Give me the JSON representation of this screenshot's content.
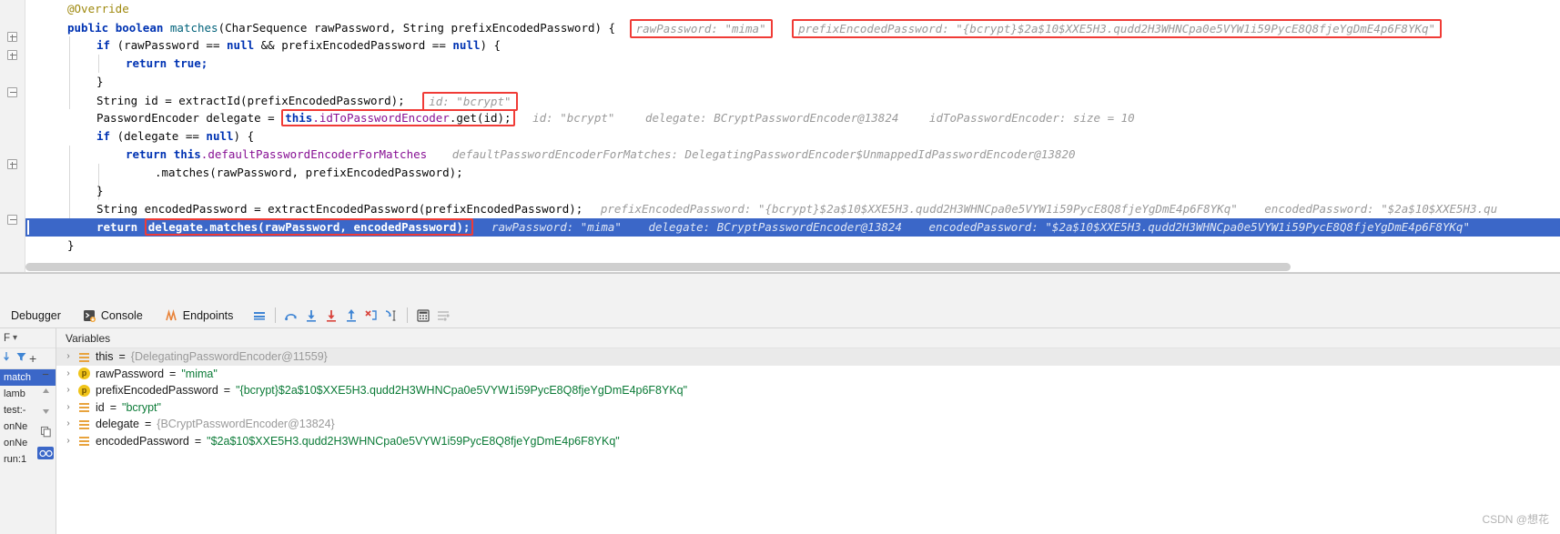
{
  "editor": {
    "lines": [
      {
        "id": "l1",
        "indent": 1,
        "text": "@Override"
      },
      {
        "id": "l2",
        "indent": 1,
        "text": "public boolean matches(CharSequence rawPassword, String prefixEncodedPassword) {"
      },
      {
        "id": "l3",
        "indent": 2,
        "text": "if (rawPassword == null && prefixEncodedPassword == null) {"
      },
      {
        "id": "l4",
        "indent": 3,
        "text": "return true;"
      },
      {
        "id": "l5",
        "indent": 2,
        "text": "}"
      },
      {
        "id": "l6",
        "indent": 2,
        "text": "String id = extractId(prefixEncodedPassword);"
      },
      {
        "id": "l7",
        "indent": 2,
        "text": "PasswordEncoder delegate = this.idToPasswordEncoder.get(id);"
      },
      {
        "id": "l8",
        "indent": 2,
        "text": "if (delegate == null) {"
      },
      {
        "id": "l9",
        "indent": 3,
        "text": "return this.defaultPasswordEncoderForMatches"
      },
      {
        "id": "l10",
        "indent": 4,
        "text": ".matches(rawPassword, prefixEncodedPassword);"
      },
      {
        "id": "l11",
        "indent": 2,
        "text": "}"
      },
      {
        "id": "l12",
        "indent": 2,
        "text": "String encodedPassword = extractEncodedPassword(prefixEncodedPassword);"
      },
      {
        "id": "l13",
        "indent": 2,
        "text": "return delegate.matches(rawPassword, encodedPassword);"
      },
      {
        "id": "l14",
        "indent": 1,
        "text": "}"
      }
    ],
    "tokens": {
      "annotation_override": "@Override",
      "kw_public": "public",
      "kw_boolean": "boolean",
      "method_matches": "matches",
      "sig_rest": "(CharSequence rawPassword, String prefixEncodedPassword) {",
      "kw_if": "if",
      "if_raw_null": "(rawPassword == ",
      "kw_null": "null",
      "and_prefix": " && prefixEncodedPassword == ",
      "close_brace_paren": ") {",
      "kw_return": "return",
      "kw_true": "true;",
      "brace_close": "}",
      "line6_a": "String id = extractId(prefixEncodedPassword);",
      "line7_a": "PasswordEncoder delegate = ",
      "line7_box": "this.idToPasswordEncoder.get(id);",
      "line7_this": "this",
      "line7_dot_field": ".idToPasswordEncoder",
      "line7_get": ".get(id);",
      "line8_a": "if (delegate == ",
      "line8_b": ") {",
      "line9_return": "return ",
      "line9_this": "this",
      "line9_field": ".defaultPasswordEncoderForMatches",
      "line10_a": ".matches(rawPassword, prefixEncodedPassword);",
      "line12_a": "String encodedPassword = extractEncodedPassword(prefixEncodedPassword);",
      "line13_return": "return ",
      "line13_box": "delegate.matches(rawPassword, encodedPassword);"
    },
    "inline_hints": {
      "raw_password": "rawPassword: \"mima\"",
      "prefix_encoded_password": "prefixEncodedPassword: \"{bcrypt}$2a$10$XXE5H3.qudd2H3WHNCpa0e5VYW1i59PycE8Q8fjeYgDmE4p6F8YKq\"",
      "id_bcrypt": "id: \"bcrypt\"",
      "id_bcrypt_2": "id: \"bcrypt\"",
      "delegate_bcrypt": "delegate: BCryptPasswordEncoder@13824",
      "idtopasswordencoder_size": "idToPasswordEncoder:  size = 10",
      "default_encoder_for_matches": "defaultPasswordEncoderForMatches: DelegatingPasswordEncoder$UnmappedIdPasswordEncoder@13820",
      "prefix_encoded_password_2": "prefixEncodedPassword: \"{bcrypt}$2a$10$XXE5H3.qudd2H3WHNCpa0e5VYW1i59PycE8Q8fjeYgDmE4p6F8YKq\"",
      "encoded_password_trunc": "encodedPassword: \"$2a$10$XXE5H3.qu",
      "raw_password_2": "rawPassword: \"mima\"",
      "delegate_bcrypt_2": "delegate: BCryptPasswordEncoder@13824",
      "encoded_password_2": "encodedPassword: \"$2a$10$XXE5H3.qudd2H3WHNCpa0e5VYW1i59PycE8Q8fjeYgDmE4p6F8YKq\""
    }
  },
  "tool_window": {
    "tabs": [
      {
        "id": "debugger",
        "label": "Debugger",
        "icon": "debugger-icon",
        "active": true
      },
      {
        "id": "console",
        "label": "Console",
        "icon": "console-icon",
        "active": false
      },
      {
        "id": "endpoints",
        "label": "Endpoints",
        "icon": "endpoints-icon",
        "active": false
      }
    ],
    "toolbar_buttons": [
      {
        "id": "layout-settings",
        "icon": "layout-settings-icon",
        "title": "Layout Settings"
      },
      {
        "id": "step-over",
        "icon": "step-over-icon",
        "title": "Step Over"
      },
      {
        "id": "step-into",
        "icon": "step-into-icon",
        "title": "Step Into"
      },
      {
        "id": "force-step-into",
        "icon": "force-step-into-icon",
        "title": "Force Step Into"
      },
      {
        "id": "step-out",
        "icon": "step-out-icon",
        "title": "Step Out"
      },
      {
        "id": "drop-frame",
        "icon": "drop-frame-icon",
        "title": "Drop Frame"
      },
      {
        "id": "run-to-cursor",
        "icon": "run-to-cursor-icon",
        "title": "Run to Cursor"
      },
      {
        "id": "evaluate-expression",
        "icon": "calculator-icon",
        "title": "Evaluate Expression"
      },
      {
        "id": "settings-filter",
        "icon": "filter-settings-icon",
        "title": "Settings"
      }
    ]
  },
  "frames_panel": {
    "selector_label": "F",
    "chevron": "▾",
    "items": [
      {
        "id": "matches",
        "label": "match",
        "selected": true
      },
      {
        "id": "lambda",
        "label": "lamb",
        "selected": false
      },
      {
        "id": "test",
        "label": "test:-",
        "selected": false
      },
      {
        "id": "onNew1",
        "label": "onNe",
        "selected": false
      },
      {
        "id": "onNew2",
        "label": "onNe",
        "selected": false
      },
      {
        "id": "run17",
        "label": "run:1",
        "selected": false
      }
    ],
    "toolbar": [
      {
        "id": "sort-frames",
        "icon": "arrow-down-icon"
      },
      {
        "id": "filter-frames",
        "icon": "funnel-icon"
      },
      {
        "id": "add-watch",
        "icon": "plus-icon"
      },
      {
        "id": "remove-watch",
        "icon": "minus-icon"
      },
      {
        "id": "move-up",
        "icon": "triangle-up-icon"
      },
      {
        "id": "move-down",
        "icon": "triangle-down-icon"
      },
      {
        "id": "copy-stack",
        "icon": "copy-icon"
      },
      {
        "id": "mute-breakpoints",
        "icon": "glasses-icon"
      }
    ]
  },
  "variables_panel": {
    "header": "Variables",
    "rows": [
      {
        "id": "this",
        "arrow": "›",
        "icon": "field-icon",
        "name": "this",
        "eq": " = ",
        "value": "{DelegatingPasswordEncoder@11559}",
        "value_type": "object",
        "selected": true
      },
      {
        "id": "rawPassword",
        "arrow": "›",
        "icon": "param-icon",
        "name": "rawPassword",
        "eq": " = ",
        "value": "\"mima\"",
        "value_type": "string",
        "selected": false
      },
      {
        "id": "prefixEncodedPassword",
        "arrow": "›",
        "icon": "param-icon",
        "name": "prefixEncodedPassword",
        "eq": " = ",
        "value": "\"{bcrypt}$2a$10$XXE5H3.qudd2H3WHNCpa0e5VYW1i59PycE8Q8fjeYgDmE4p6F8YKq\"",
        "value_type": "string",
        "selected": false
      },
      {
        "id": "id",
        "arrow": "›",
        "icon": "field-icon",
        "name": "id",
        "eq": " = ",
        "value": "\"bcrypt\"",
        "value_type": "string",
        "selected": false
      },
      {
        "id": "delegate",
        "arrow": "›",
        "icon": "field-icon",
        "name": "delegate",
        "eq": " = ",
        "value": "{BCryptPasswordEncoder@13824}",
        "value_type": "object",
        "selected": false
      },
      {
        "id": "encodedPassword",
        "arrow": "›",
        "icon": "field-icon",
        "name": "encodedPassword",
        "eq": " = ",
        "value": "\"$2a$10$XXE5H3.qudd2H3WHNCpa0e5VYW1i59PycE8Q8fjeYgDmE4p6F8YKq\"",
        "value_type": "string",
        "selected": false
      }
    ]
  },
  "watermark": {
    "text": "CSDN @想花"
  },
  "colors": {
    "keyword": "#0033b3",
    "annotation": "#9e880d",
    "method": "#00627a",
    "field": "#871094",
    "hint_gray": "#9a9a9a",
    "highlight_blue": "#3b67c8",
    "box_red": "#f03b36",
    "string_green": "#0a7a36"
  }
}
